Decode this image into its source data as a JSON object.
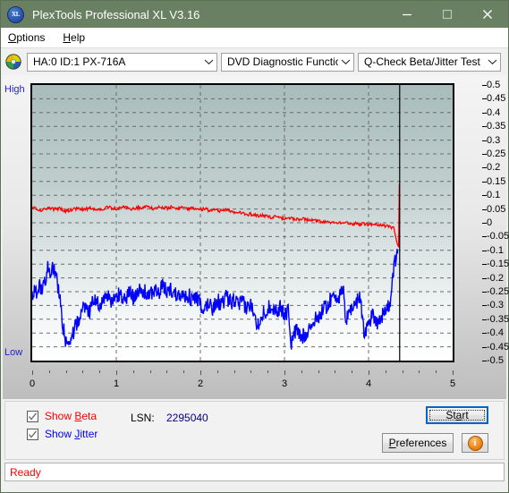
{
  "window": {
    "title": "PlexTools Professional XL V3.16",
    "app_icon": "xl-logo-icon",
    "minimize": "minimize-icon",
    "maximize": "maximize-icon",
    "close": "close-icon"
  },
  "menubar": {
    "items": [
      {
        "label": "Options",
        "accel": "O"
      },
      {
        "label": "Help",
        "accel": "H"
      }
    ]
  },
  "toolbar": {
    "disc_icon": "cd-disc-icon",
    "drive_select": {
      "value": "HA:0 ID:1  PX-716A"
    },
    "function_select": {
      "value": "DVD Diagnostic Functions"
    },
    "test_select": {
      "value": "Q-Check Beta/Jitter Test"
    }
  },
  "chart": {
    "high_label": "High",
    "low_label": "Low"
  },
  "controls": {
    "show_beta": {
      "label_pre": "Show ",
      "accel": "B",
      "label_post": "eta",
      "checked": true
    },
    "show_jitter": {
      "label_pre": "Show ",
      "accel": "J",
      "label_post": "itter",
      "checked": true
    },
    "lsn_label": "LSN:",
    "lsn_value": "2295040",
    "start_pre": "St",
    "start_accel": "a",
    "start_post": "rt",
    "pref_pre": "",
    "pref_accel": "P",
    "pref_post": "references",
    "info_icon": "info-icon",
    "info_glyph": "i"
  },
  "statusbar": {
    "text": "Ready"
  },
  "chart_data": {
    "type": "line",
    "title": "Q-Check Beta/Jitter Test",
    "xlabel": "",
    "ylabel": "",
    "xlim": [
      0,
      5
    ],
    "ylim": [
      -0.5,
      0.5
    ],
    "xticks": [
      0,
      1,
      2,
      3,
      4,
      5
    ],
    "yticks": [
      0.5,
      0.45,
      0.4,
      0.35,
      0.3,
      0.25,
      0.2,
      0.15,
      0.1,
      0.05,
      0,
      -0.05,
      -0.1,
      -0.15,
      -0.2,
      -0.25,
      -0.3,
      -0.35,
      -0.4,
      -0.45,
      -0.5
    ],
    "ytick_labels": [
      "0.5",
      "0.45",
      "0.4",
      "0.35",
      "0.3",
      "0.25",
      "0.2",
      "0.15",
      "0.1",
      "0.05",
      "0",
      "-0.05",
      "-0.1",
      "-0.15",
      "-0.2",
      "-0.25",
      "-0.3",
      "-0.35",
      "-0.4",
      "-0.45",
      "-0.5"
    ],
    "grid": true,
    "left_axis_high": "High",
    "left_axis_low": "Low",
    "marker_x": 4.37,
    "colors": {
      "beta": "#ff0000",
      "jitter": "#0000ff",
      "marker": "#000000"
    },
    "series": [
      {
        "name": "Beta",
        "color": "#ff0000",
        "x": [
          0.0,
          0.05,
          0.1,
          0.15,
          0.2,
          0.25,
          0.3,
          0.35,
          0.4,
          0.45,
          0.5,
          0.55,
          0.6,
          0.65,
          0.7,
          0.75,
          0.8,
          0.85,
          0.9,
          0.95,
          1.0,
          1.05,
          1.1,
          1.15,
          1.2,
          1.25,
          1.3,
          1.35,
          1.4,
          1.45,
          1.5,
          1.55,
          1.6,
          1.65,
          1.7,
          1.75,
          1.8,
          1.85,
          1.9,
          1.95,
          2.0,
          2.05,
          2.1,
          2.15,
          2.2,
          2.25,
          2.3,
          2.35,
          2.4,
          2.45,
          2.5,
          2.55,
          2.6,
          2.65,
          2.7,
          2.75,
          2.8,
          2.85,
          2.9,
          2.95,
          3.0,
          3.05,
          3.1,
          3.15,
          3.2,
          3.25,
          3.3,
          3.35,
          3.4,
          3.45,
          3.5,
          3.55,
          3.6,
          3.65,
          3.7,
          3.75,
          3.8,
          3.85,
          3.9,
          3.95,
          4.0,
          4.05,
          4.1,
          4.15,
          4.2,
          4.25,
          4.3,
          4.33,
          4.35,
          4.36,
          4.37,
          4.37
        ],
        "y": [
          0.055,
          0.053,
          0.044,
          0.048,
          0.056,
          0.05,
          0.052,
          0.049,
          0.043,
          0.046,
          0.049,
          0.052,
          0.048,
          0.051,
          0.055,
          0.05,
          0.047,
          0.052,
          0.056,
          0.053,
          0.05,
          0.054,
          0.058,
          0.053,
          0.05,
          0.055,
          0.052,
          0.057,
          0.054,
          0.052,
          0.058,
          0.055,
          0.053,
          0.056,
          0.051,
          0.055,
          0.053,
          0.05,
          0.054,
          0.051,
          0.047,
          0.05,
          0.046,
          0.049,
          0.045,
          0.042,
          0.046,
          0.043,
          0.04,
          0.036,
          0.033,
          0.03,
          0.032,
          0.028,
          0.025,
          0.027,
          0.023,
          0.02,
          0.022,
          0.018,
          0.015,
          0.017,
          0.014,
          0.012,
          0.015,
          0.011,
          0.008,
          0.01,
          0.006,
          0.004,
          0.007,
          0.003,
          0.0,
          0.002,
          -0.002,
          0.0,
          -0.004,
          -0.002,
          -0.005,
          -0.003,
          -0.006,
          -0.008,
          -0.005,
          -0.008,
          -0.011,
          -0.014,
          -0.02,
          -0.06,
          -0.085,
          -0.09,
          0.3,
          0.5
        ]
      },
      {
        "name": "Jitter",
        "color": "#0000ff",
        "x": [
          0.0,
          0.03,
          0.06,
          0.09,
          0.12,
          0.15,
          0.18,
          0.21,
          0.24,
          0.27,
          0.3,
          0.33,
          0.36,
          0.39,
          0.42,
          0.45,
          0.48,
          0.51,
          0.54,
          0.57,
          0.6,
          0.64,
          0.68,
          0.72,
          0.76,
          0.8,
          0.85,
          0.9,
          0.95,
          1.0,
          1.05,
          1.1,
          1.15,
          1.2,
          1.25,
          1.3,
          1.35,
          1.4,
          1.45,
          1.5,
          1.55,
          1.6,
          1.65,
          1.7,
          1.75,
          1.8,
          1.85,
          1.9,
          1.95,
          2.0,
          2.02,
          2.05,
          2.1,
          2.15,
          2.2,
          2.25,
          2.3,
          2.35,
          2.4,
          2.45,
          2.5,
          2.55,
          2.6,
          2.65,
          2.68,
          2.7,
          2.75,
          2.8,
          2.85,
          2.9,
          2.95,
          3.0,
          3.05,
          3.08,
          3.1,
          3.15,
          3.2,
          3.25,
          3.3,
          3.35,
          3.4,
          3.45,
          3.5,
          3.55,
          3.6,
          3.65,
          3.7,
          3.73,
          3.75,
          3.8,
          3.85,
          3.9,
          3.95,
          4.0,
          4.02,
          4.05,
          4.1,
          4.15,
          4.2,
          4.25,
          4.28,
          4.3,
          4.33,
          4.35,
          4.36,
          4.37
        ],
        "y": [
          -0.27,
          -0.24,
          -0.26,
          -0.23,
          -0.25,
          -0.22,
          -0.16,
          -0.18,
          -0.15,
          -0.17,
          -0.22,
          -0.28,
          -0.36,
          -0.42,
          -0.44,
          -0.43,
          -0.41,
          -0.38,
          -0.36,
          -0.34,
          -0.32,
          -0.3,
          -0.33,
          -0.29,
          -0.27,
          -0.3,
          -0.28,
          -0.27,
          -0.29,
          -0.27,
          -0.26,
          -0.28,
          -0.25,
          -0.27,
          -0.24,
          -0.26,
          -0.25,
          -0.27,
          -0.24,
          -0.26,
          -0.23,
          -0.25,
          -0.24,
          -0.26,
          -0.25,
          -0.27,
          -0.26,
          -0.28,
          -0.27,
          -0.29,
          -0.35,
          -0.31,
          -0.29,
          -0.31,
          -0.28,
          -0.3,
          -0.27,
          -0.29,
          -0.28,
          -0.3,
          -0.29,
          -0.31,
          -0.3,
          -0.32,
          -0.38,
          -0.35,
          -0.33,
          -0.31,
          -0.3,
          -0.32,
          -0.31,
          -0.33,
          -0.32,
          -0.44,
          -0.41,
          -0.39,
          -0.42,
          -0.4,
          -0.38,
          -0.36,
          -0.34,
          -0.32,
          -0.3,
          -0.28,
          -0.26,
          -0.27,
          -0.25,
          -0.36,
          -0.33,
          -0.31,
          -0.29,
          -0.27,
          -0.4,
          -0.37,
          -0.35,
          -0.33,
          -0.36,
          -0.34,
          -0.32,
          -0.3,
          -0.22,
          -0.16,
          -0.13,
          -0.12
        ]
      }
    ]
  }
}
